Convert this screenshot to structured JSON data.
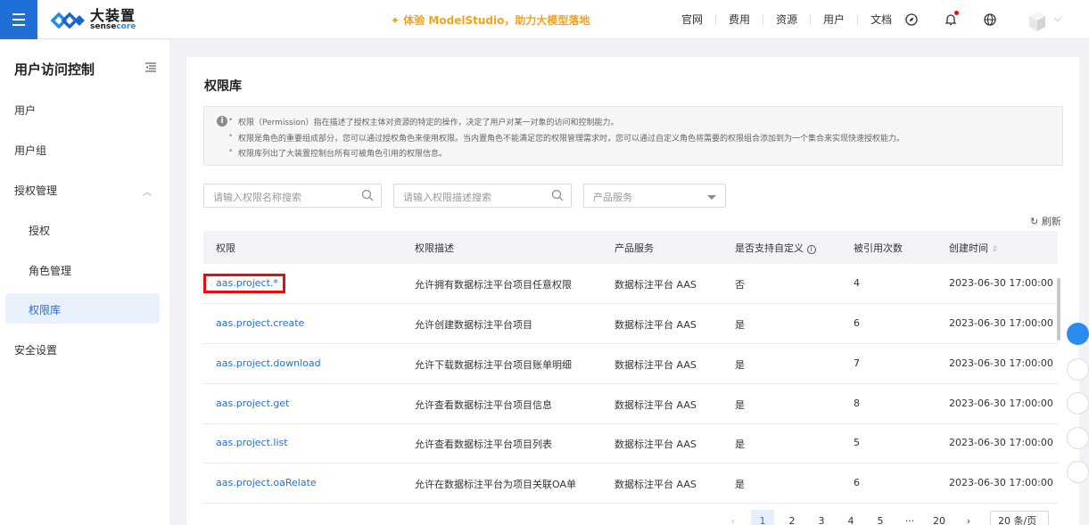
{
  "topbar": {
    "logo_text": "大装置",
    "logo_sub_a": "sense",
    "logo_sub_b": "core",
    "promo": "体验 ModelStudio，助力大模型落地",
    "nav": [
      "官网",
      "费用",
      "资源",
      "用户",
      "文档"
    ]
  },
  "sidebar": {
    "title": "用户访问控制",
    "items": {
      "users": "用户",
      "groups": "用户组",
      "auth": "授权管理",
      "grant": "授权",
      "roles": "角色管理",
      "perm_lib": "权限库",
      "security": "安全设置"
    }
  },
  "main": {
    "title": "权限库",
    "info": [
      "权限（Permission）指在描述了授权主体对资源的特定的操作，决定了用户对某一对象的访问和控制能力。",
      "权限是角色的重要组成部分，您可以通过授权角色来使用权限。当内置角色不能满足您的权限管理需求时，您可以通过自定义角色将需要的权限组合添加到为一个集合来实现快速授权能力。",
      "权限库列出了大装置控制台所有可被角色引用的权限信息。"
    ],
    "search_name_placeholder": "请输入权限名称搜索",
    "search_desc_placeholder": "请输入权限描述搜索",
    "product_select": "产品服务",
    "refresh": "刷新",
    "columns": [
      "权限",
      "权限描述",
      "产品服务",
      "是否支持自定义",
      "被引用次数",
      "创建时间"
    ],
    "rows": [
      {
        "perm": "aas.project.*",
        "desc": "允许拥有数据标注平台项目任意权限",
        "product": "数据标注平台 AAS",
        "custom": "否",
        "refs": "4",
        "created": "2023-06-30 17:00:00"
      },
      {
        "perm": "aas.project.create",
        "desc": "允许创建数据标注平台项目",
        "product": "数据标注平台 AAS",
        "custom": "是",
        "refs": "6",
        "created": "2023-06-30 17:00:00"
      },
      {
        "perm": "aas.project.download",
        "desc": "允许下载数据标注平台项目账单明细",
        "product": "数据标注平台 AAS",
        "custom": "是",
        "refs": "7",
        "created": "2023-06-30 17:00:00"
      },
      {
        "perm": "aas.project.get",
        "desc": "允许查看数据标注平台项目信息",
        "product": "数据标注平台 AAS",
        "custom": "是",
        "refs": "8",
        "created": "2023-06-30 17:00:00"
      },
      {
        "perm": "aas.project.list",
        "desc": "允许查看数据标注平台项目列表",
        "product": "数据标注平台 AAS",
        "custom": "是",
        "refs": "5",
        "created": "2023-06-30 17:00:00"
      },
      {
        "perm": "aas.project.oaRelate",
        "desc": "允许在数据标注平台为项目关联OA单",
        "product": "数据标注平台 AAS",
        "custom": "是",
        "refs": "6",
        "created": "2023-06-30 17:00:00"
      }
    ],
    "pagination": {
      "prev": "‹",
      "pages": [
        "1",
        "2",
        "3",
        "4",
        "5",
        "···",
        "20"
      ],
      "next": "›",
      "page_size": "20 条/页"
    }
  },
  "colors": {
    "primary": "#1f6fd6",
    "promo": "#f5a21b",
    "highlight": "#e01010"
  }
}
